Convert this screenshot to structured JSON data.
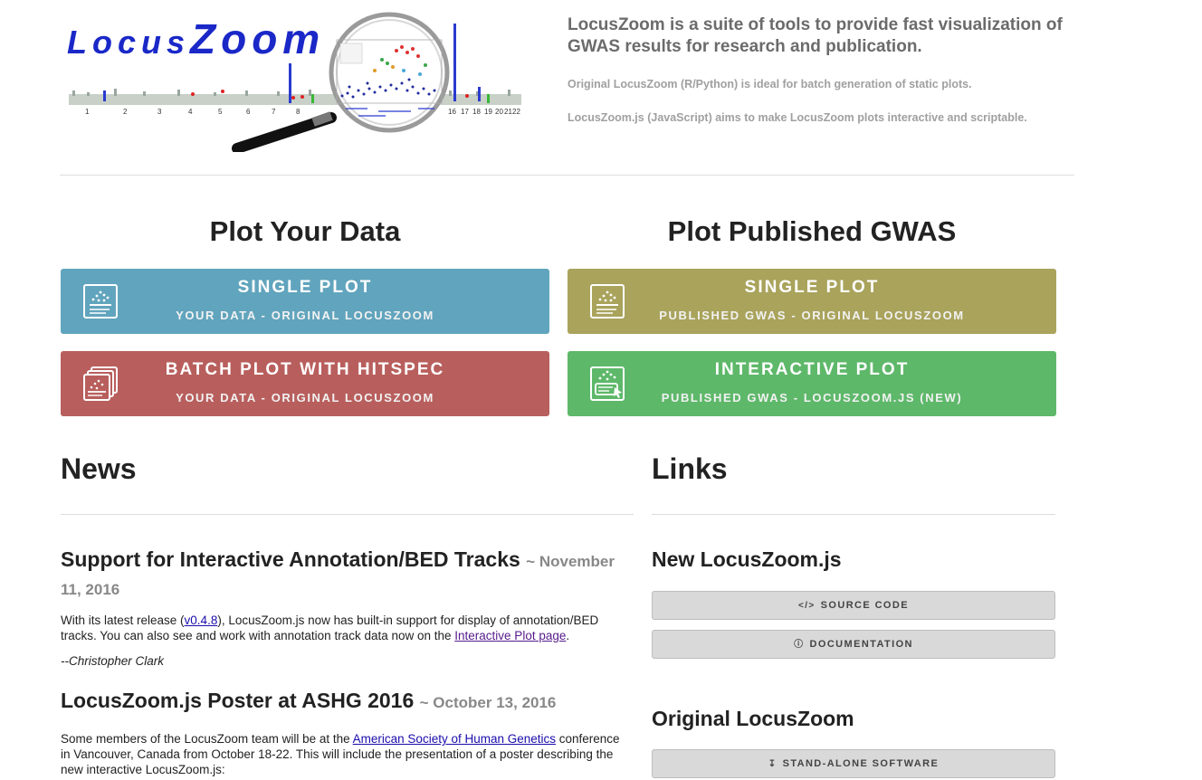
{
  "logo": {
    "text_small": "Locus",
    "text_big": "Zoom",
    "chromosomes": [
      "1",
      "2",
      "3",
      "4",
      "5",
      "6",
      "7",
      "8",
      "16",
      "17",
      "18",
      "19",
      "20",
      "21",
      "22"
    ]
  },
  "intro": {
    "headline": "LocusZoom is a suite of tools to provide fast visualization of GWAS results for research and publication.",
    "line1": "Original LocusZoom (R/Python) is ideal for batch generation of static plots.",
    "line2": "LocusZoom.js (JavaScript) aims to make LocusZoom plots interactive and scriptable."
  },
  "sections": {
    "plot_your_data": "Plot Your Data",
    "plot_published": "Plot Published GWAS"
  },
  "buttons": {
    "single_your": {
      "title": "SINGLE PLOT",
      "subtitle": "YOUR DATA - ORIGINAL LOCUSZOOM",
      "color": "#61a4bd",
      "icon": "scatter-plot-icon"
    },
    "batch_your": {
      "title": "BATCH PLOT WITH HITSPEC",
      "subtitle": "YOUR DATA - ORIGINAL LOCUSZOOM",
      "color": "#b85f5d",
      "icon": "stacked-plots-icon"
    },
    "single_published": {
      "title": "SINGLE PLOT",
      "subtitle": "PUBLISHED GWAS - ORIGINAL LOCUSZOOM",
      "color": "#a9a35c",
      "icon": "scatter-plot-icon"
    },
    "interactive_published": {
      "title": "INTERACTIVE PLOT",
      "subtitle": "PUBLISHED GWAS - LOCUSZOOM.JS (NEW)",
      "color": "#5eb86a",
      "icon": "interactive-plot-icon"
    }
  },
  "news": {
    "heading": "News",
    "items": [
      {
        "title": "Support for Interactive Annotation/BED Tracks",
        "date": "~ November 11, 2016",
        "p1_before": "With its latest release (",
        "p1_link": "v0.4.8",
        "p1_mid": "), LocusZoom.js now has built-in support for display of annotation/BED tracks. You can also see and work with annotation track data now on the ",
        "p1_link2": "Interactive Plot page",
        "p1_after": ".",
        "signature": "--Christopher Clark"
      },
      {
        "title": "LocusZoom.js Poster at ASHG 2016",
        "date": "~ October 13, 2016",
        "p1_before": "Some members of the LocusZoom team will be at the ",
        "p1_link": "American Society of Human Genetics",
        "p1_after": " conference in Vancouver, Canada from October 18-22. This will include the presentation of a poster describing the new interactive LocusZoom.js:"
      }
    ]
  },
  "links": {
    "heading": "Links",
    "group1": "New LocusZoom.js",
    "source_code": "SOURCE CODE",
    "documentation": "DOCUMENTATION",
    "group2": "Original LocusZoom",
    "standalone": "STAND-ALONE SOFTWARE"
  }
}
